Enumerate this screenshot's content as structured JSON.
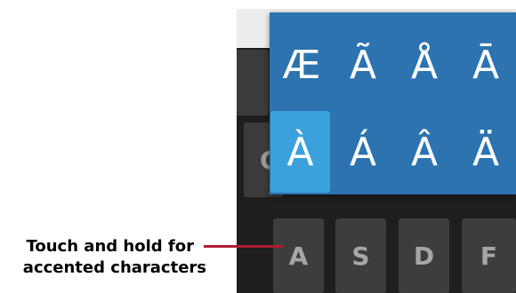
{
  "accent_popup": {
    "rows": [
      [
        "Æ",
        "Ã",
        "Å",
        "Ā"
      ],
      [
        "À",
        "Á",
        "Â",
        "Ä"
      ]
    ],
    "selected": "À"
  },
  "background_key": {
    "label": "C"
  },
  "keyboard": {
    "home_row": [
      "A",
      "S",
      "D",
      "F"
    ]
  },
  "callout": {
    "line1": "Touch and hold for",
    "line2": "accented characters"
  },
  "colors": {
    "popup": "#2c73b0",
    "selected_key": "#3aa1dc",
    "key": "#3d3d3d",
    "leader_line": "#b01c2e"
  }
}
